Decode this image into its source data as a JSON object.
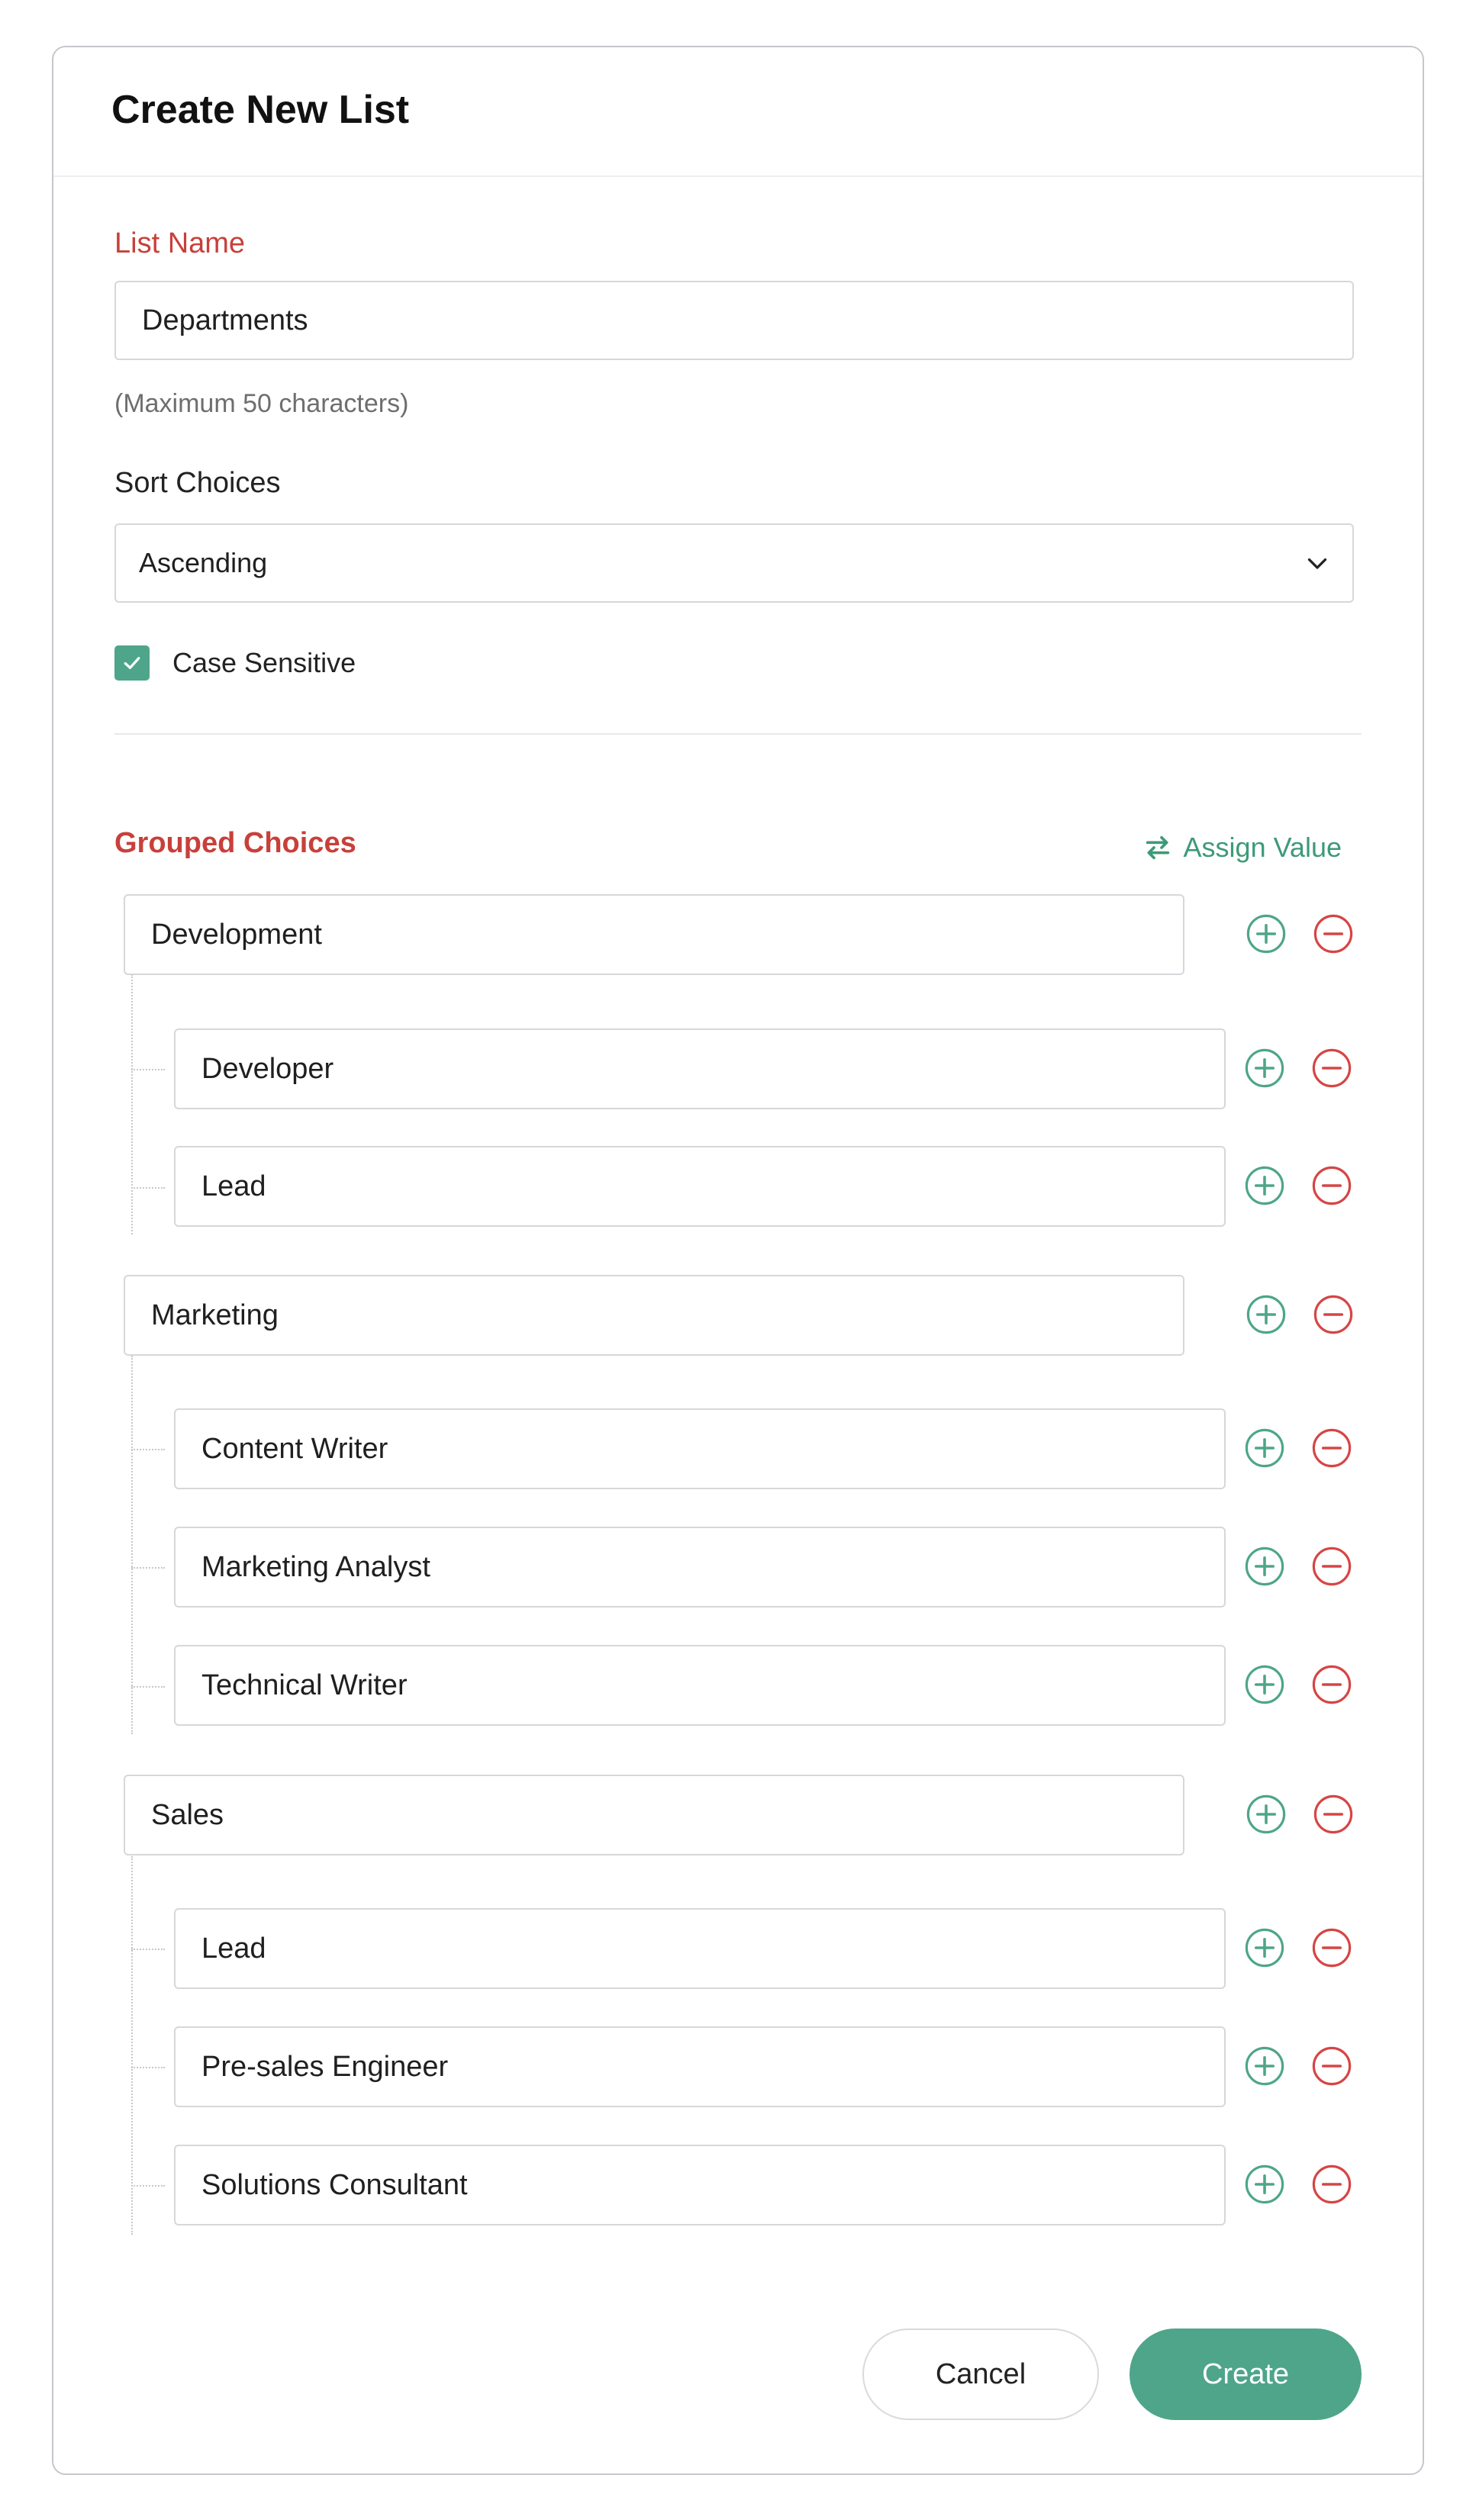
{
  "dialog": {
    "title": "Create New List"
  },
  "list_name": {
    "label": "List Name",
    "value": "Departments",
    "hint": "(Maximum 50 characters)"
  },
  "sort": {
    "label": "Sort Choices",
    "selected": "Ascending"
  },
  "case_sensitive": {
    "label": "Case Sensitive",
    "checked": true
  },
  "grouped": {
    "label": "Grouped Choices",
    "assign_label": "Assign Value",
    "groups": [
      {
        "name": "Development",
        "children": [
          "Developer",
          "Lead"
        ]
      },
      {
        "name": "Marketing",
        "children": [
          "Content Writer",
          "Marketing Analyst",
          "Technical Writer"
        ]
      },
      {
        "name": "Sales",
        "children": [
          "Lead",
          "Pre-sales Engineer",
          "Solutions Consultant"
        ]
      }
    ]
  },
  "footer": {
    "cancel_label": "Cancel",
    "create_label": "Create"
  },
  "colors": {
    "accent": "#4ea58a",
    "danger": "#d64545",
    "label_red": "#c8403a"
  },
  "icons": {
    "add": "plus-circle-icon",
    "remove": "minus-circle-icon",
    "assign": "swap-arrows-icon",
    "dropdown": "chevron-down-icon",
    "check": "check-icon"
  }
}
